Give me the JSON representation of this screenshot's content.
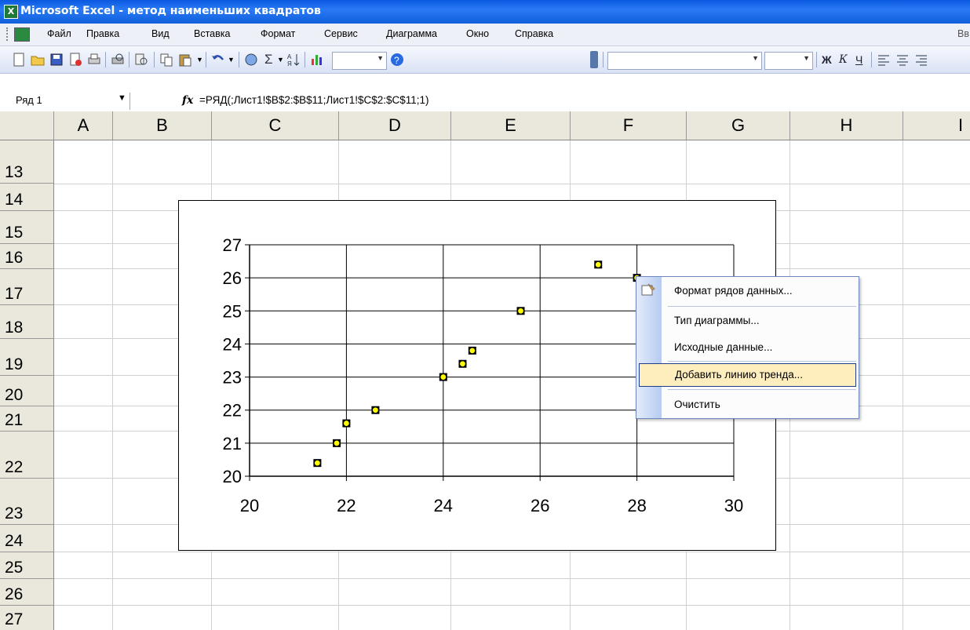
{
  "window": {
    "title": "Microsoft Excel - метод наименьших квадратов"
  },
  "menu": {
    "items": [
      "Файл",
      "Правка",
      "Вид",
      "Вставка",
      "Формат",
      "Сервис",
      "Диаграмма",
      "Окно",
      "Справка"
    ],
    "right_truncated": "Вв"
  },
  "formula_bar": {
    "name_box": "Ряд 1",
    "fx_label": "fx",
    "formula": "=РЯД(;Лист1!$B$2:$B$11;Лист1!$C$2:$C$11;1)"
  },
  "columns": [
    "A",
    "B",
    "C",
    "D",
    "E",
    "F",
    "G",
    "H",
    "I"
  ],
  "rows": [
    "13",
    "14",
    "15",
    "16",
    "17",
    "18",
    "19",
    "20",
    "21",
    "22",
    "23",
    "24",
    "25",
    "26",
    "27"
  ],
  "chart_data": {
    "type": "scatter",
    "x_ticks": [
      "20",
      "22",
      "24",
      "26",
      "28",
      "30"
    ],
    "y_ticks": [
      "20",
      "21",
      "22",
      "23",
      "24",
      "25",
      "26",
      "27"
    ],
    "xlim": [
      20,
      30
    ],
    "ylim": [
      20,
      27
    ],
    "grid": true,
    "marker_color": "#ffff00",
    "points": [
      {
        "x": 21.4,
        "y": 20.4
      },
      {
        "x": 21.8,
        "y": 21.0
      },
      {
        "x": 22.0,
        "y": 21.6
      },
      {
        "x": 22.6,
        "y": 22.0
      },
      {
        "x": 24.0,
        "y": 23.0
      },
      {
        "x": 24.4,
        "y": 23.4
      },
      {
        "x": 24.6,
        "y": 23.8
      },
      {
        "x": 25.6,
        "y": 25.0
      },
      {
        "x": 27.2,
        "y": 26.4
      },
      {
        "x": 28.0,
        "y": 26.0
      }
    ]
  },
  "context_menu": {
    "items": [
      {
        "label": "Формат рядов данных...",
        "highlighted": false
      },
      {
        "label": "Тип диаграммы...",
        "highlighted": false
      },
      {
        "label": "Исходные данные...",
        "highlighted": false
      },
      {
        "label": "Добавить линию тренда...",
        "highlighted": true
      },
      {
        "label": "Очистить",
        "highlighted": false
      }
    ]
  },
  "colors": {
    "titlebar": "#0a58e0",
    "highlight": "#ffeebd",
    "menu_strip": "#b7cbf1"
  }
}
